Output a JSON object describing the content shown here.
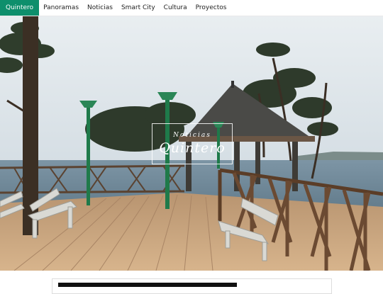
{
  "nav": {
    "brand": "Quintero",
    "items": [
      "Panoramas",
      "Noticias",
      "Smart City",
      "Cultura",
      "Proyectos"
    ]
  },
  "hero": {
    "subtitle": "Noticias",
    "title": "Quintero"
  },
  "colors": {
    "brand_green": "#0e8f6c",
    "lamp_green": "#1f7a4a",
    "deck_wood": "#c8a27a",
    "railing_brown": "#6b4a32"
  },
  "icons": [
    "street-lamp-icon"
  ]
}
